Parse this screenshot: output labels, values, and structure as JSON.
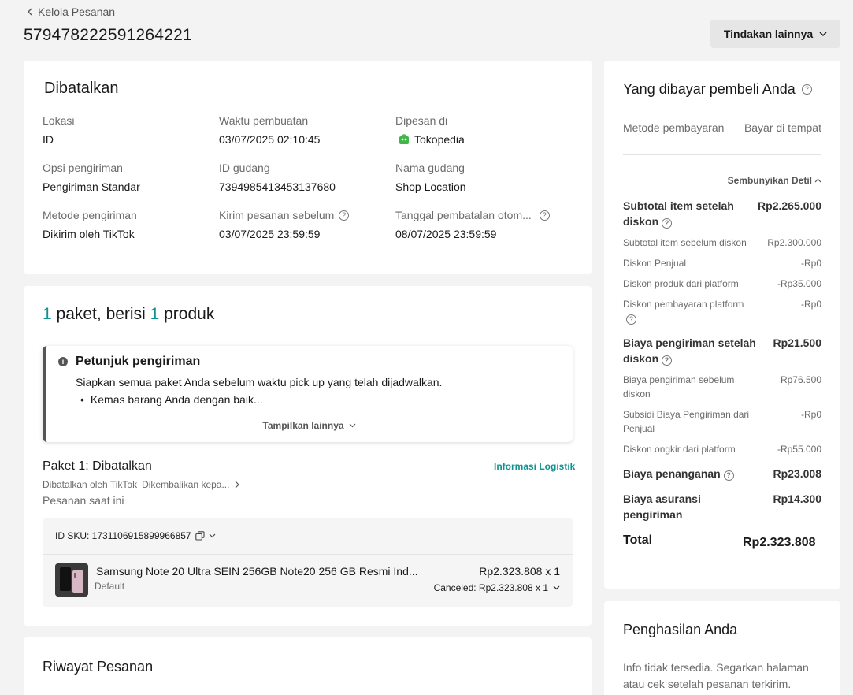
{
  "header": {
    "back_label": "Kelola Pesanan",
    "order_id": "579478222591264221",
    "more_actions_label": "Tindakan lainnya"
  },
  "order_status": {
    "title": "Dibatalkan",
    "fields": {
      "location_label": "Lokasi",
      "location_value": "ID",
      "created_label": "Waktu pembuatan",
      "created_value": "03/07/2025 02:10:45",
      "ordered_at_label": "Dipesan di",
      "ordered_at_value": "Tokopedia",
      "shipping_option_label": "Opsi pengiriman",
      "shipping_option_value": "Pengiriman Standar",
      "warehouse_id_label": "ID gudang",
      "warehouse_id_value": "7394985413453137680",
      "warehouse_name_label": "Nama gudang",
      "warehouse_name_value": "Shop Location",
      "shipping_method_label": "Metode pengiriman",
      "shipping_method_value": "Dikirim oleh TikTok",
      "ship_before_label": "Kirim pesanan sebelum",
      "ship_before_value": "03/07/2025 23:59:59",
      "auto_cancel_label": "Tanggal pembatalan otom...",
      "auto_cancel_value": "08/07/2025 23:59:59"
    }
  },
  "packages": {
    "count": "1",
    "mid_text": " paket, berisi ",
    "product_count": "1",
    "end_text": " produk",
    "guide": {
      "title": "Petunjuk pengiriman",
      "text": "Siapkan semua paket Anda sebelum waktu pick up yang telah dijadwalkan.",
      "bullet": "Kemas barang Anda dengan baik...",
      "show_more": "Tampilkan lainnya"
    },
    "package1": {
      "title": "Paket 1: Dibatalkan",
      "logistics_link": "Informasi Logistik",
      "cancelled_by": "Dibatalkan oleh TikTok",
      "returned": "Dikembalikan kepa...",
      "current_label": "Pesanan saat ini",
      "sku_line": "ID SKU: 1731106915899966857",
      "product_name": "Samsung Note 20 Ultra SEIN 256GB Note20 256 GB Resmi Ind...",
      "variant": "Default",
      "price_qty": "Rp2.323.808 x 1",
      "cancel_line": "Canceled: Rp2.323.808 x 1"
    }
  },
  "history": {
    "title": "Riwayat Pesanan"
  },
  "payment": {
    "title": "Yang dibayar pembeli Anda",
    "method_label": "Metode pembayaran",
    "method_value": "Bayar di tempat",
    "hide_detail": "Sembunyikan Detil",
    "rows": [
      {
        "label": "Subtotal item setelah diskon",
        "value": "Rp2.265.000"
      },
      {
        "label": "Subtotal item sebelum diskon",
        "value": "Rp2.300.000"
      },
      {
        "label": "Diskon Penjual",
        "value": "-Rp0"
      },
      {
        "label": "Diskon produk dari platform",
        "value": "-Rp35.000"
      },
      {
        "label": "Diskon pembayaran platform",
        "value": "-Rp0"
      },
      {
        "label": "Biaya pengiriman setelah diskon",
        "value": "Rp21.500"
      },
      {
        "label": "Biaya pengiriman sebelum diskon",
        "value": "Rp76.500"
      },
      {
        "label": "Subsidi Biaya Pengiriman dari Penjual",
        "value": "-Rp0"
      },
      {
        "label": "Diskon ongkir dari platform",
        "value": "-Rp55.000"
      },
      {
        "label": "Biaya penanganan",
        "value": "Rp23.008"
      },
      {
        "label": "Biaya asuransi pengiriman",
        "value": "Rp14.300"
      }
    ],
    "total_label": "Total",
    "total_value": "Rp2.323.808"
  },
  "earnings": {
    "title": "Penghasilan Anda",
    "text": "Info tidak tersedia. Segarkan halaman atau cek setelah pesanan terkirim."
  },
  "colors": {
    "accent": "#0f9190",
    "background": "#f3f3f3",
    "card": "#ffffff"
  }
}
